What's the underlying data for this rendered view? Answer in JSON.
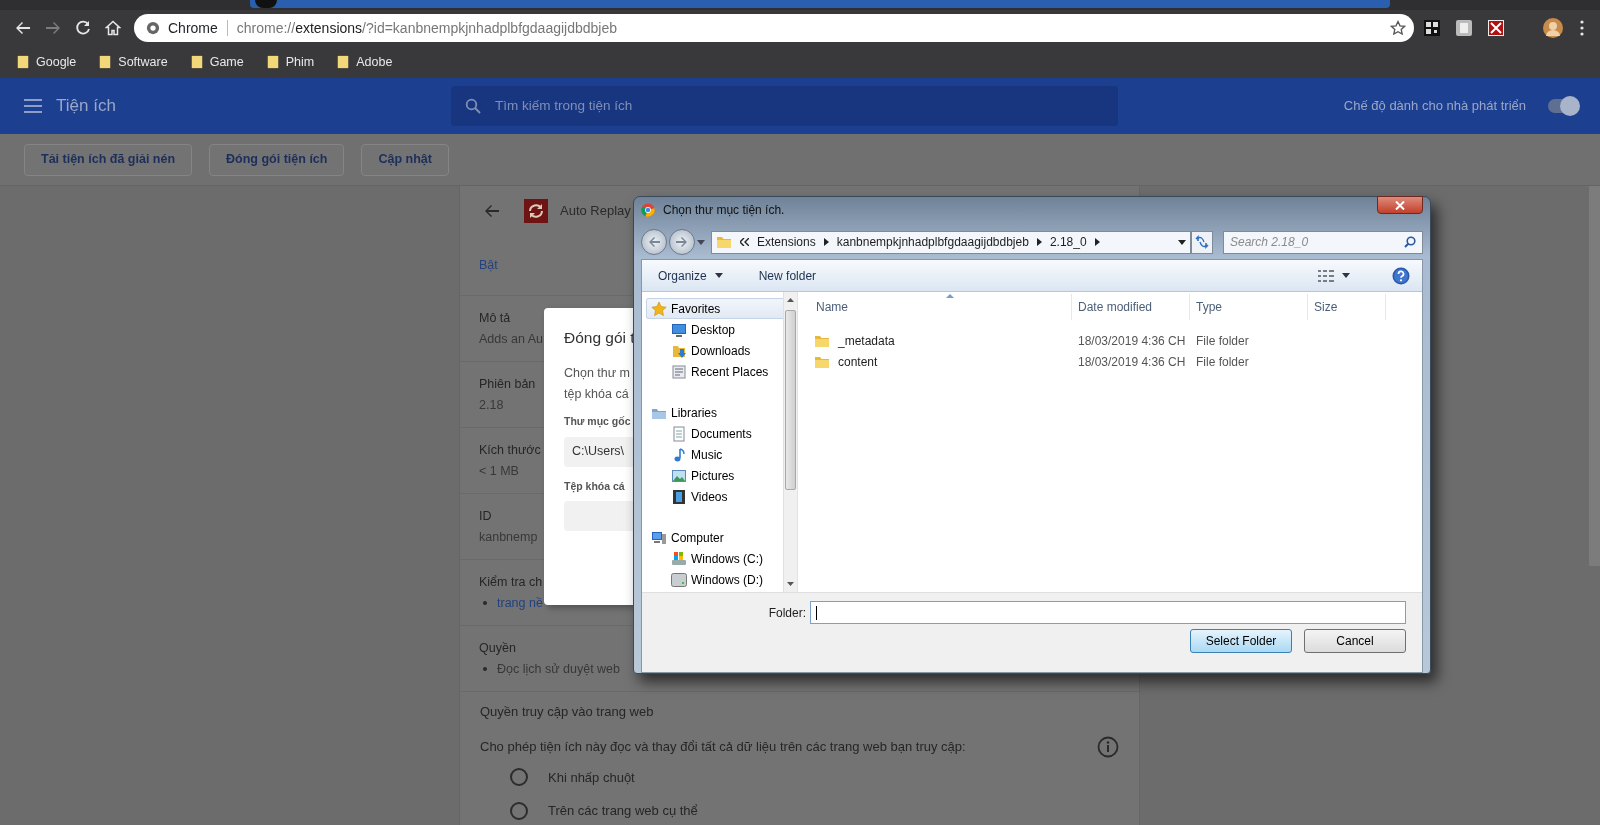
{
  "browser": {
    "forward_disabled": true,
    "omnibox": {
      "site_label": "Chrome",
      "scheme": "chrome://",
      "host": "extensions",
      "path": "/?id=kanbnempkjnhadplbfgdaagijdbdbjeb"
    },
    "bookmarks": [
      {
        "label": "Google"
      },
      {
        "label": "Software"
      },
      {
        "label": "Game"
      },
      {
        "label": "Phim"
      },
      {
        "label": "Adobe"
      }
    ]
  },
  "header": {
    "title": "Tiện ích",
    "search_placeholder": "Tìm kiếm trong tiện ích",
    "dev_mode_label": "Chế độ dành cho nhà phát triển",
    "dev_mode_on": true
  },
  "toolbar_buttons": [
    "Tải tiện ích đã giải nén",
    "Đóng gói tiện ích",
    "Cập nhật"
  ],
  "details": {
    "name": "Auto Replay",
    "state_label": "Bật",
    "sections": [
      {
        "label": "Mô tả",
        "value": "Adds an Au"
      },
      {
        "label": "Phiên bản",
        "value": "2.18"
      },
      {
        "label": "Kích thước",
        "value": "< 1 MB"
      },
      {
        "label": "ID",
        "value": "kanbnemp"
      },
      {
        "label": "Kiểm tra ch",
        "link": "trang nề"
      },
      {
        "label": "Quyền",
        "bullet": "Đọc lịch sử duyệt web"
      }
    ],
    "site_access": {
      "title": "Quyền truy cập vào trang web",
      "prompt": "Cho phép tiện ích này đọc và thay đổi tất cả dữ liệu trên các trang web bạn truy cập:",
      "options": [
        {
          "label": "Khi nhấp chuột",
          "selected": false
        },
        {
          "label": "Trên các trang web cụ thể",
          "selected": false
        }
      ]
    }
  },
  "pack_dialog": {
    "title": "Đóng gói t",
    "description_lines": [
      "Chọn thư m",
      "tệp khóa cá"
    ],
    "root_label": "Thư mục gốc",
    "root_value": "C:\\Users\\",
    "key_label": "Tệp khóa cá"
  },
  "file_dialog": {
    "title": "Chọn thư mục tiện ích.",
    "breadcrumb": [
      "Extensions",
      "kanbnempkjnhadplbfgdaagijdbdbjeb",
      "2.18_0"
    ],
    "search_placeholder": "Search 2.18_0",
    "commands": [
      "Organize",
      "New folder"
    ],
    "nav": [
      {
        "label": "Favorites",
        "kind": "star",
        "selected": true,
        "children": [
          {
            "label": "Desktop",
            "kind": "desktop",
            "selected": false
          },
          {
            "label": "Downloads",
            "kind": "downloads",
            "selected": false
          },
          {
            "label": "Recent Places",
            "kind": "recent",
            "selected": false
          }
        ]
      },
      {
        "label": "Libraries",
        "kind": "library",
        "selected": false,
        "children": [
          {
            "label": "Documents",
            "kind": "document",
            "selected": false
          },
          {
            "label": "Music",
            "kind": "music",
            "selected": false
          },
          {
            "label": "Pictures",
            "kind": "pictures",
            "selected": false
          },
          {
            "label": "Videos",
            "kind": "videos",
            "selected": false
          }
        ]
      },
      {
        "label": "Computer",
        "kind": "computer",
        "selected": false,
        "children": [
          {
            "label": "Windows (C:)",
            "kind": "system-drive",
            "selected": false
          },
          {
            "label": "Windows (D:)",
            "kind": "drive",
            "selected": false
          }
        ]
      }
    ],
    "columns": [
      "Name",
      "Date modified",
      "Type",
      "Size"
    ],
    "rows": [
      {
        "name": "_metadata",
        "date": "18/03/2019 4:36 CH",
        "type": "File folder"
      },
      {
        "name": "content",
        "date": "18/03/2019 4:36 CH",
        "type": "File folder"
      }
    ],
    "folder_label": "Folder:",
    "buttons": [
      {
        "label": "Select Folder",
        "default": true
      },
      {
        "label": "Cancel",
        "default": false
      }
    ]
  }
}
